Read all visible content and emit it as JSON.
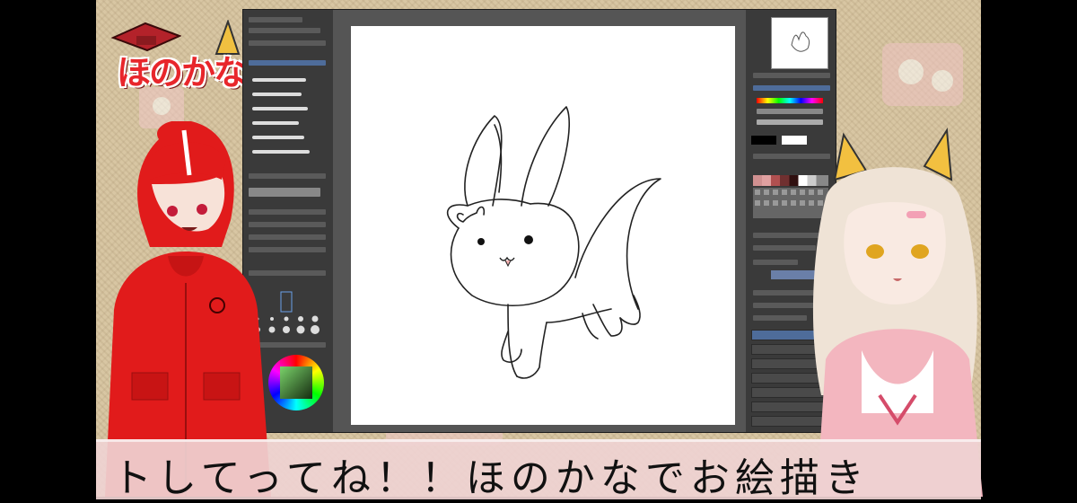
{
  "logo": {
    "text": "ほのかな"
  },
  "subtitle": {
    "text": "トしてってね！！ほのかなでお絵描き"
  },
  "app": {
    "left_panel_sections": [
      "brush",
      "tool-property",
      "brush-size",
      "color-wheel"
    ],
    "right_panel_sections": [
      "navigator",
      "color-slider",
      "color-set",
      "layer-property",
      "layers"
    ]
  },
  "colors": {
    "accent_red": "#e8262b",
    "subtitle_bg": "#efd2d2",
    "app_bg": "#3c3c3c"
  }
}
